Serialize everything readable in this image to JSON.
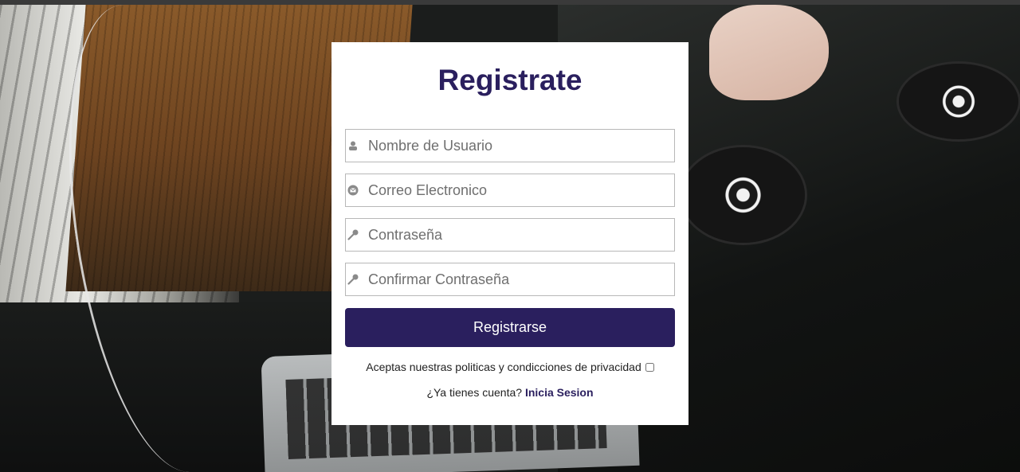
{
  "form": {
    "title": "Registrate",
    "fields": [
      {
        "placeholder": "Nombre de Usuario",
        "icon": "user-icon"
      },
      {
        "placeholder": "Correo Electronico",
        "icon": "mail-icon"
      },
      {
        "placeholder": "Contraseña",
        "icon": "key-icon"
      },
      {
        "placeholder": "Confirmar Contraseña",
        "icon": "key-icon"
      }
    ],
    "submit_label": "Registrarse",
    "terms_text": "Aceptas nuestras politicas y condicciones de privacidad",
    "login_prompt": "¿Ya tienes cuenta?",
    "login_link": "Inicia Sesion"
  },
  "colors": {
    "accent": "#2a1f5e",
    "card_bg": "#ffffff",
    "input_border": "#b8b8b8"
  }
}
